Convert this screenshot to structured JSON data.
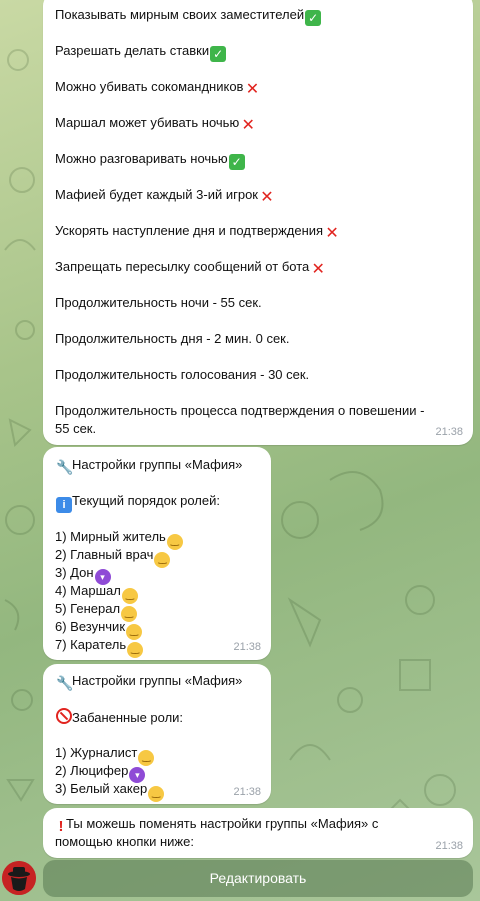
{
  "settings_message": {
    "lines": [
      {
        "text": "Показывать мирным своих заместителей",
        "icon": "check-icon"
      },
      {
        "text": "Разрешать делать ставки",
        "icon": "check-icon"
      },
      {
        "text": "Можно убивать сокомандников",
        "icon": "cross-icon"
      },
      {
        "text": "Маршал может убивать ночью",
        "icon": "cross-icon"
      },
      {
        "text": "Можно разговаривать ночью",
        "icon": "check-icon"
      },
      {
        "text": "Мафией будет каждый 3-ий игрок",
        "icon": "cross-icon"
      },
      {
        "text": "Ускорять наступление дня и подтверждения",
        "icon": "cross-icon"
      },
      {
        "text": "Запрещать пересылку сообщений от бота",
        "icon": "cross-icon"
      },
      {
        "text": "Продолжительность ночи - 55 сек."
      },
      {
        "text": "Продолжительность дня - 2 мин. 0 сек."
      },
      {
        "text": "Продолжительность голосования - 30 сек."
      },
      {
        "text": "Продолжительность процесса подтверждения о повешении -"
      },
      {
        "text": "55 сек."
      }
    ],
    "time": "21:38"
  },
  "roles_message": {
    "title": "Настройки группы «Мафия»",
    "subtitle": "Текущий порядок ролей:",
    "roles": [
      {
        "text": "1) Мирный житель",
        "icon": "slightly-smiling-face-icon"
      },
      {
        "text": "2) Главный врач",
        "icon": "slightly-smiling-face-icon"
      },
      {
        "text": "3) Дон",
        "icon": "smiling-devil-icon"
      },
      {
        "text": "4) Маршал",
        "icon": "slightly-smiling-face-icon"
      },
      {
        "text": "5) Генерал",
        "icon": "slightly-smiling-face-icon"
      },
      {
        "text": "6) Везунчик",
        "icon": "slightly-smiling-face-icon"
      },
      {
        "text": "7) Каратель",
        "icon": "slightly-smiling-face-icon"
      }
    ],
    "time": "21:38"
  },
  "banned_message": {
    "title": "Настройки группы «Мафия»",
    "subtitle": "Забаненные роли:",
    "roles": [
      {
        "text": "1) Журналист",
        "icon": "slightly-smiling-face-icon"
      },
      {
        "text": "2) Люцифер",
        "icon": "smiling-devil-icon"
      },
      {
        "text": "3) Белый хакер",
        "icon": "slightly-smiling-face-icon"
      }
    ],
    "time": "21:38"
  },
  "change_message": {
    "line1": "Ты можешь поменять настройки группы «Мафия» с",
    "line2": "помощью кнопки ниже:",
    "time": "21:38"
  },
  "inline_button": {
    "label": "Редактировать"
  }
}
